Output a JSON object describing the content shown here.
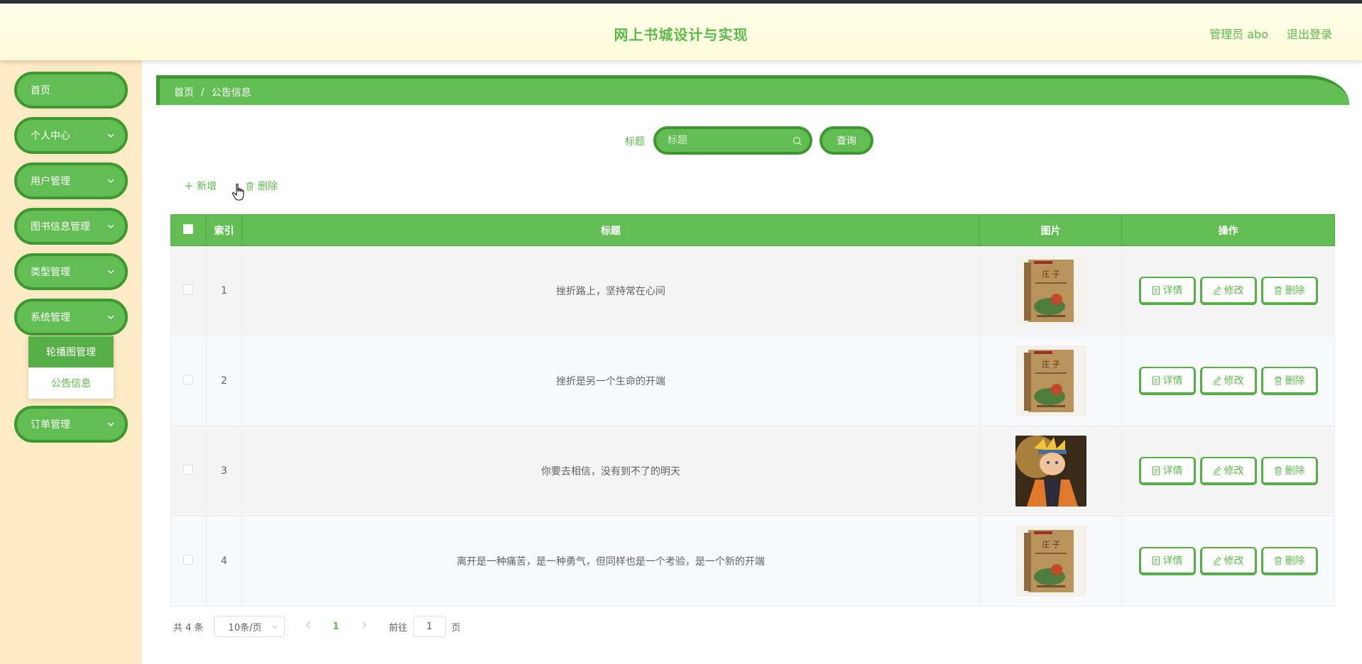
{
  "header": {
    "title": "网上书城设计与实现",
    "user": "管理员 abo",
    "logout": "退出登录"
  },
  "sidebar": {
    "items": [
      {
        "label": "首页",
        "has_arrow": false
      },
      {
        "label": "个人中心",
        "has_arrow": true
      },
      {
        "label": "用户管理",
        "has_arrow": true
      },
      {
        "label": "图书信息管理",
        "has_arrow": true
      },
      {
        "label": "类型管理",
        "has_arrow": true
      },
      {
        "label": "系统管理",
        "has_arrow": true,
        "expanded": true
      },
      {
        "label": "订单管理",
        "has_arrow": true
      }
    ],
    "submenu": [
      {
        "label": "轮播图管理",
        "active": true
      },
      {
        "label": "公告信息",
        "active": false
      }
    ]
  },
  "breadcrumb": {
    "home": "首页",
    "separator": "/",
    "current": "公告信息"
  },
  "search": {
    "label": "标题",
    "placeholder": "标题",
    "button": "查询"
  },
  "actions": {
    "add": "新增",
    "delete": "删除"
  },
  "table": {
    "columns": [
      "索引",
      "标题",
      "图片",
      "操作"
    ],
    "rows": [
      {
        "index": "1",
        "title": "挫折路上，坚持常在心间",
        "image": "book-cover"
      },
      {
        "index": "2",
        "title": "挫折是另一个生命的开端",
        "image": "book-cover"
      },
      {
        "index": "3",
        "title": "你要去相信，没有到不了的明天",
        "image": "anime-character"
      },
      {
        "index": "4",
        "title": "离开是一种痛苦，是一种勇气，但同样也是一个考验，是一个新的开端",
        "image": "book-cover"
      }
    ],
    "row_actions": {
      "detail": "详情",
      "edit": "修改",
      "delete": "删除"
    }
  },
  "pagination": {
    "total": "共 4 条",
    "page_size": "10条/页",
    "current_page": "1",
    "goto_prefix": "前往",
    "goto_value": "1",
    "goto_suffix": "页"
  },
  "colors": {
    "primary": "#62bd52",
    "primary_dark": "#3f9732",
    "sidebar_bg": "#feeac3",
    "header_bg": "#fefbd9"
  }
}
